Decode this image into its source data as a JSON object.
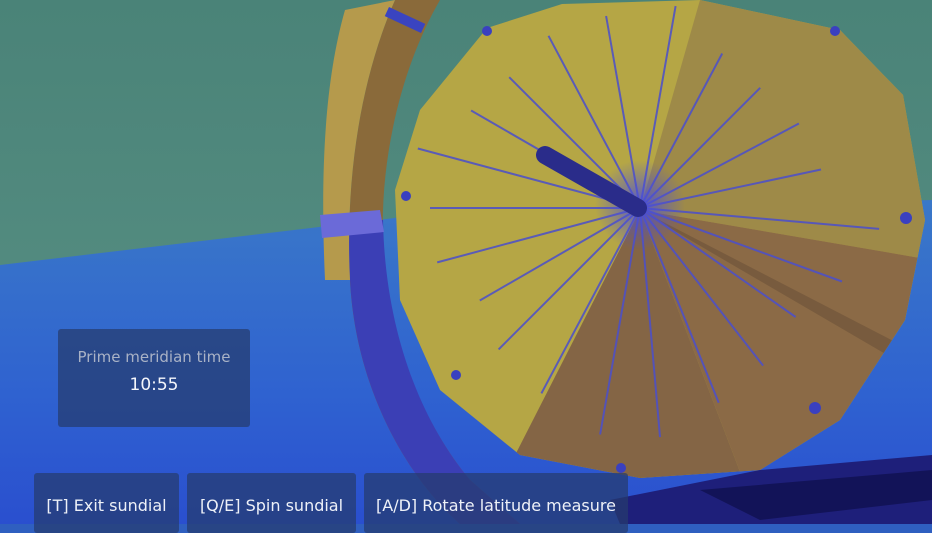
{
  "hud": {
    "time_label": "Prime meridian time",
    "time_value": "10:55"
  },
  "controls": [
    {
      "text": "[T] Exit sundial"
    },
    {
      "text": "[Q/E] Spin sundial"
    },
    {
      "text": "[A/D] Rotate latitude measure"
    }
  ],
  "colors": {
    "sky": "#4f8a7d",
    "ground": "#2f5fcc",
    "dial_face": "#b9a843",
    "dial_shadow": "#8f6e45",
    "ring": "#3a3fb0",
    "hour_lines": "#4a4fc8"
  }
}
